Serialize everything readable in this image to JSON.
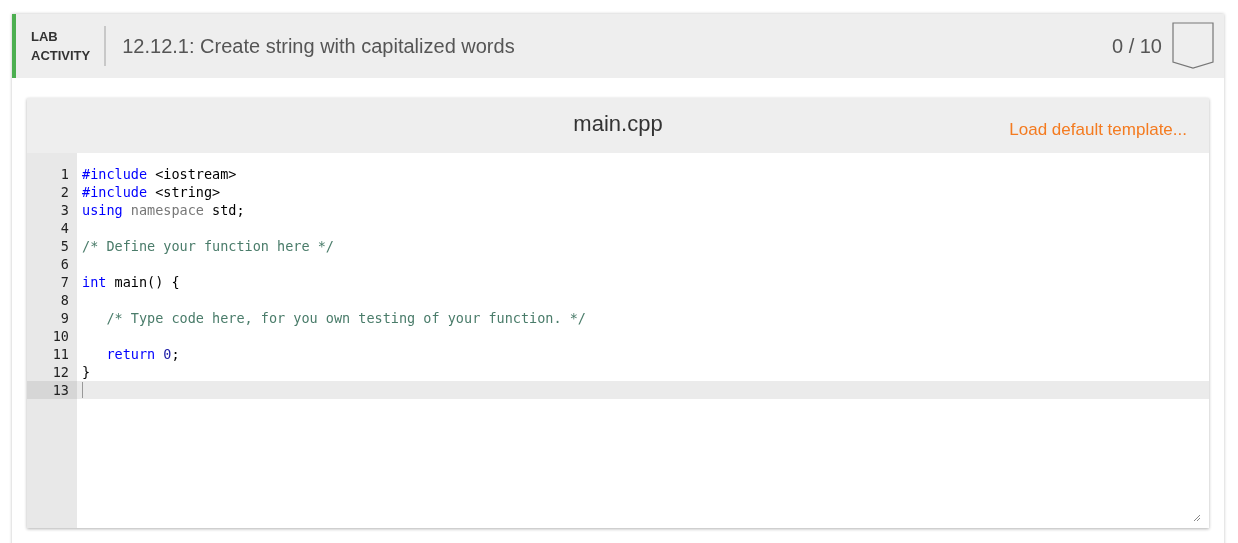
{
  "activity": {
    "label_lines": [
      "LAB",
      "ACTIVITY"
    ],
    "title": "12.12.1: Create string with capitalized words",
    "score": "0 / 10"
  },
  "editor": {
    "filename": "main.cpp",
    "load_link": "Load default template...",
    "lines": [
      {
        "number": "1",
        "active": false,
        "tokens": [
          {
            "kind": "keyword",
            "text": "#include"
          },
          {
            "kind": "plain",
            "text": " <iostream>"
          }
        ]
      },
      {
        "number": "2",
        "active": false,
        "tokens": [
          {
            "kind": "keyword",
            "text": "#include"
          },
          {
            "kind": "plain",
            "text": " <string>"
          }
        ]
      },
      {
        "number": "3",
        "active": false,
        "tokens": [
          {
            "kind": "keyword",
            "text": "using "
          },
          {
            "kind": "atom",
            "text": "namespace"
          },
          {
            "kind": "plain",
            "text": " std;"
          }
        ]
      },
      {
        "number": "4",
        "active": false
      },
      {
        "number": "5",
        "active": false,
        "tokens": [
          {
            "kind": "comment",
            "text": "/* Define your function here */"
          }
        ]
      },
      {
        "number": "6",
        "active": false
      },
      {
        "number": "7",
        "active": false,
        "tokens": [
          {
            "kind": "keyword",
            "text": "int"
          },
          {
            "kind": "plain",
            "text": " main() {"
          }
        ]
      },
      {
        "number": "8",
        "active": false
      },
      {
        "number": "9",
        "active": false,
        "tokens": [
          {
            "kind": "comment",
            "text": "   /* Type code here, for you own testing of your function. */"
          }
        ]
      },
      {
        "number": "10",
        "active": false
      },
      {
        "number": "11",
        "active": false,
        "tokens": [
          {
            "kind": "keyword",
            "text": "   return "
          },
          {
            "kind": "number",
            "text": "0"
          },
          {
            "kind": "plain",
            "text": ";"
          }
        ]
      },
      {
        "number": "12",
        "active": false,
        "tokens": [
          {
            "kind": "plain",
            "text": "}"
          }
        ]
      },
      {
        "number": "13",
        "active": true
      }
    ]
  }
}
